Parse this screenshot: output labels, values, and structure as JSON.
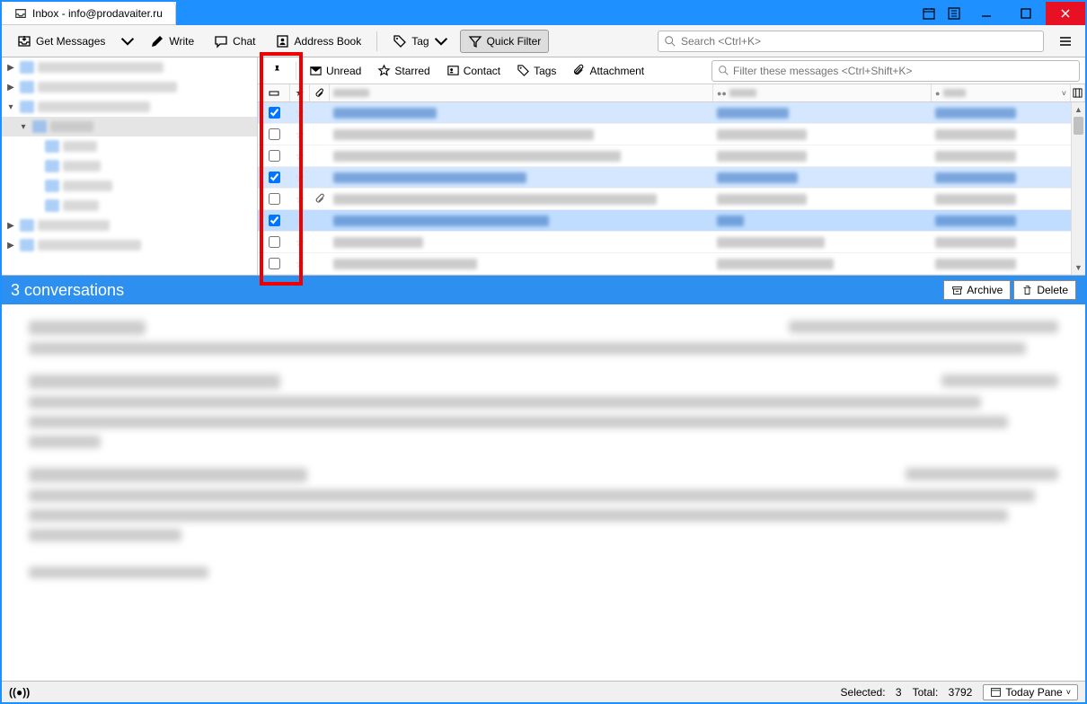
{
  "tab_title": "Inbox - info@prodavaiter.ru",
  "toolbar": {
    "get_messages": "Get Messages",
    "write": "Write",
    "chat": "Chat",
    "address_book": "Address Book",
    "tag": "Tag",
    "quick_filter": "Quick Filter",
    "search_placeholder": "Search <Ctrl+K>"
  },
  "filterbar": {
    "unread": "Unread",
    "starred": "Starred",
    "contact": "Contact",
    "tags": "Tags",
    "attachment": "Attachment",
    "filter_placeholder": "Filter these messages <Ctrl+Shift+K>"
  },
  "columns": {
    "subject": "",
    "from": "",
    "date": ""
  },
  "messages": [
    {
      "checked": true,
      "starred": false,
      "attachment": false,
      "selected": true
    },
    {
      "checked": false,
      "starred": false,
      "attachment": false,
      "selected": false
    },
    {
      "checked": false,
      "starred": false,
      "attachment": false,
      "selected": false
    },
    {
      "checked": true,
      "starred": false,
      "attachment": false,
      "selected": true
    },
    {
      "checked": false,
      "starred": false,
      "attachment": true,
      "selected": false
    },
    {
      "checked": true,
      "starred": false,
      "attachment": false,
      "selected": true,
      "focused": true
    },
    {
      "checked": false,
      "starred": false,
      "attachment": false,
      "selected": false
    },
    {
      "checked": false,
      "starred": false,
      "attachment": false,
      "selected": false
    }
  ],
  "conversation_header": "3 conversations",
  "conv_buttons": {
    "archive": "Archive",
    "delete": "Delete"
  },
  "statusbar": {
    "selected_label": "Selected:",
    "selected_count": "3",
    "total_label": "Total:",
    "total_count": "3792",
    "today_pane": "Today Pane"
  }
}
